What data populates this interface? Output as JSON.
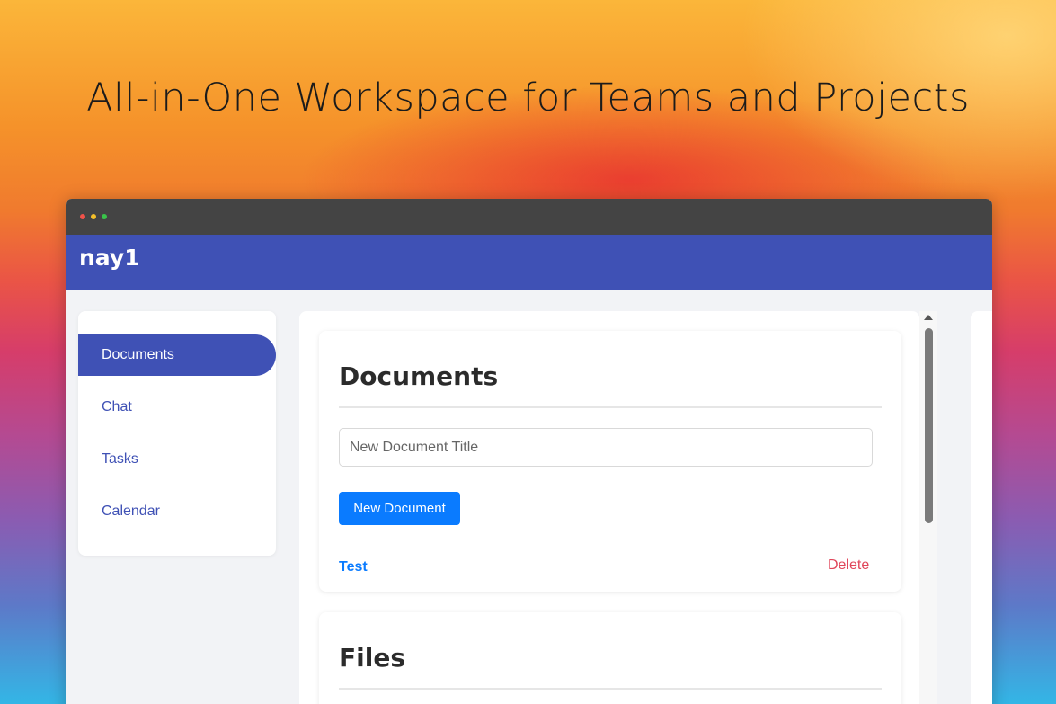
{
  "hero": {
    "title": "All-in-One Workspace for Teams and Projects"
  },
  "app": {
    "brand": "nay1"
  },
  "sidebar": {
    "items": [
      {
        "label": "Documents",
        "active": true
      },
      {
        "label": "Chat",
        "active": false
      },
      {
        "label": "Tasks",
        "active": false
      },
      {
        "label": "Calendar",
        "active": false
      }
    ]
  },
  "documents_card": {
    "title": "Documents",
    "input_placeholder": "New Document Title",
    "input_value": "",
    "new_button_label": "New Document",
    "documents": [
      {
        "title": "Test",
        "delete_label": "Delete"
      }
    ]
  },
  "files_card": {
    "title": "Files"
  },
  "colors": {
    "primary": "#3f51b5",
    "button_blue": "#0a7bff",
    "delete_red": "#e0465a",
    "titlebar": "#444444"
  }
}
